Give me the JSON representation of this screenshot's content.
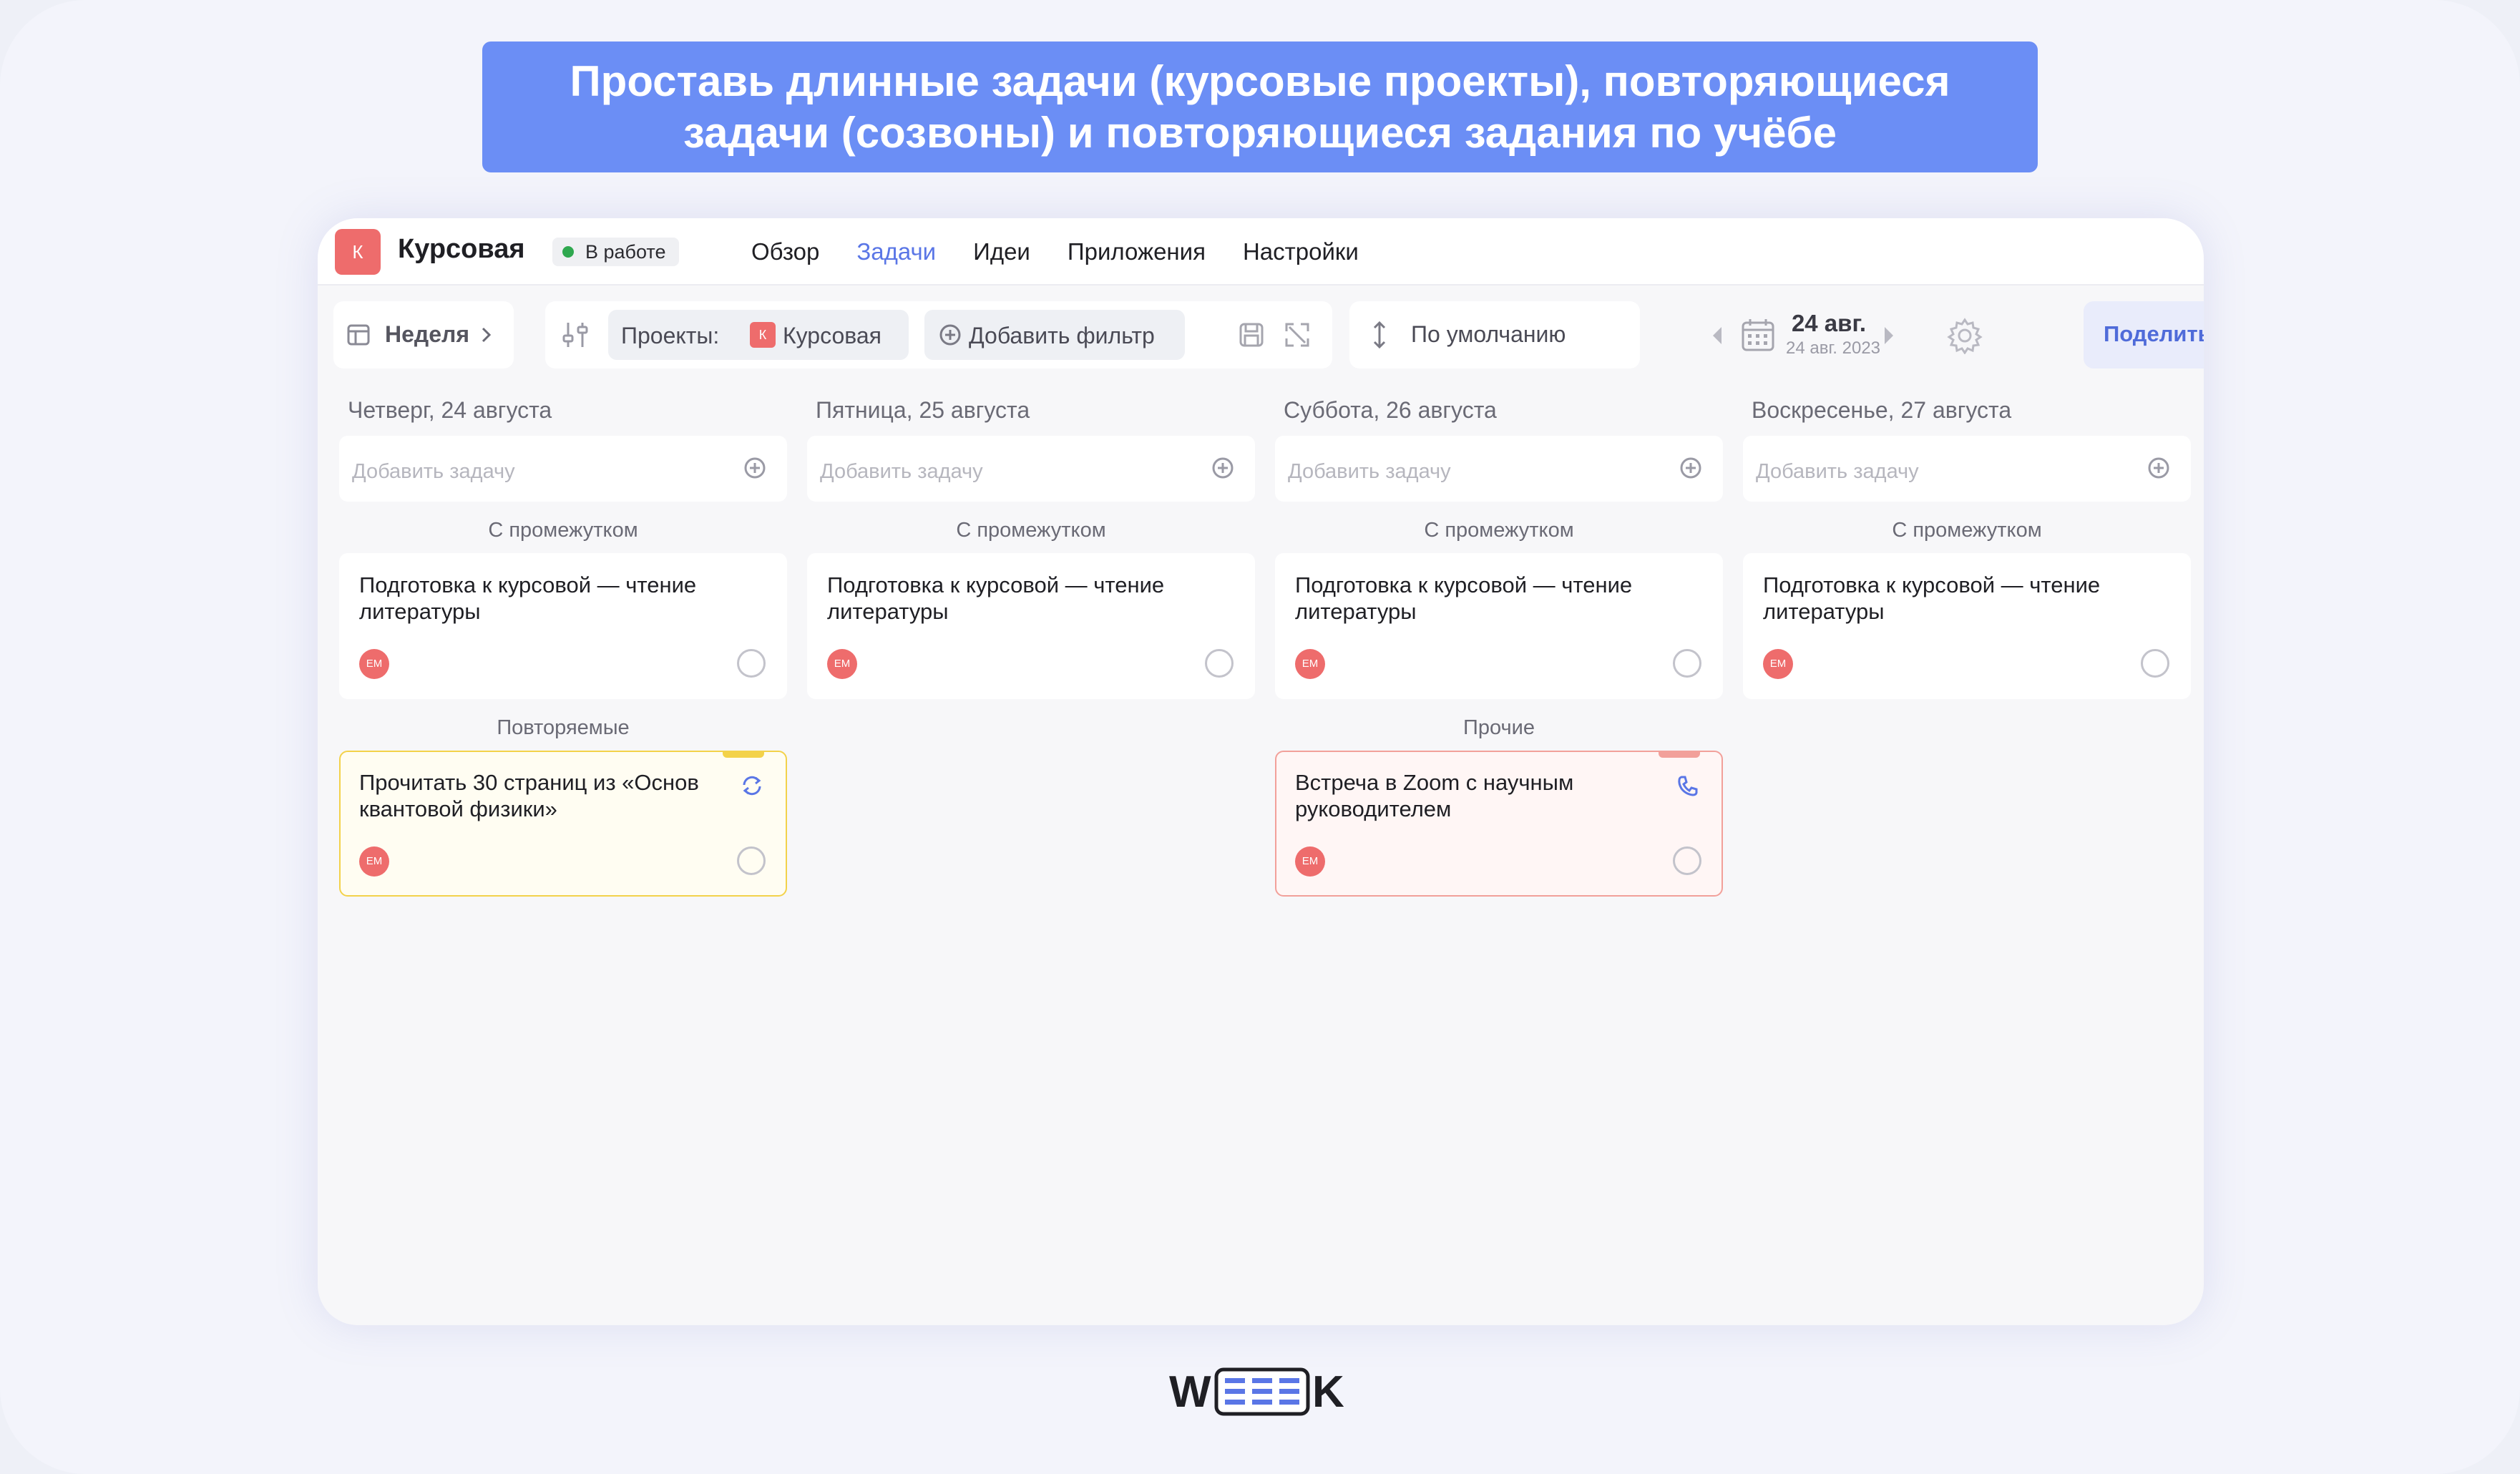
{
  "banner": {
    "line1": "Проставь длинные задачи (курсовые проекты), повторяющиеся",
    "line2": "задачи (созвоны) и повторяющиеся задания по учёбе"
  },
  "project": {
    "avatar_letter": "К",
    "title": "Курсовая",
    "status": "В работе",
    "status_color": "#2fa84f"
  },
  "nav": {
    "items": [
      "Обзор",
      "Задачи",
      "Идеи",
      "Приложения",
      "Настройки"
    ],
    "active": "Задачи"
  },
  "toolbar": {
    "view_label": "Неделя",
    "filter_label": "Проекты:",
    "filter_chip_letter": "К",
    "filter_chip_label": "Курсовая",
    "add_filter_label": "Добавить фильтр",
    "sort_label": "По умолчанию",
    "date_main": "24 авг.",
    "date_sub": "24 авг. 2023",
    "share_label": "Поделиться"
  },
  "add_task_placeholder": "Добавить задачу",
  "columns": [
    {
      "title": "Четверг, 24 августа",
      "sections": [
        {
          "label": "С промежутком",
          "cards": [
            {
              "text": "Подготовка к курсовой — чтение литературы",
              "assignee": "ЕМ",
              "style": "plain"
            }
          ]
        },
        {
          "label": "Повторяемые",
          "cards": [
            {
              "text": "Прочитать 30 страниц из «Основ квантовой физики»",
              "assignee": "ЕМ",
              "style": "yellow",
              "icon": "repeat-icon"
            }
          ]
        }
      ]
    },
    {
      "title": "Пятница, 25 августа",
      "sections": [
        {
          "label": "С промежутком",
          "cards": [
            {
              "text": "Подготовка к курсовой — чтение литературы",
              "assignee": "ЕМ",
              "style": "plain"
            }
          ]
        }
      ]
    },
    {
      "title": "Суббота, 26 августа",
      "sections": [
        {
          "label": "С промежутком",
          "cards": [
            {
              "text": "Подготовка к курсовой — чтение литературы",
              "assignee": "ЕМ",
              "style": "plain"
            }
          ]
        },
        {
          "label": "Прочие",
          "cards": [
            {
              "text": "Встреча в Zoom с научным руководителем",
              "assignee": "ЕМ",
              "style": "red",
              "icon": "phone-icon"
            }
          ]
        }
      ]
    },
    {
      "title": "Воскресенье, 27 августа",
      "sections": [
        {
          "label": "С промежутком",
          "cards": [
            {
              "text": "Подготовка к курсовой — чтение литературы",
              "assignee": "ЕМ",
              "style": "plain"
            }
          ]
        }
      ]
    }
  ],
  "colors": {
    "accent": "#5a76e6",
    "banner": "#6b8ef5",
    "avatar": "#ee6c6c",
    "yellow_border": "#f3d24a",
    "red_border": "#f2a09a"
  },
  "logo": "WEEEK"
}
